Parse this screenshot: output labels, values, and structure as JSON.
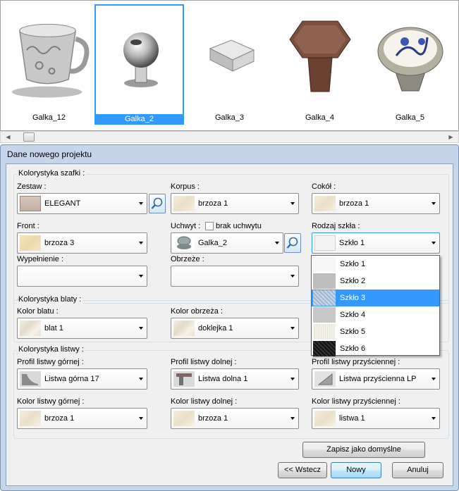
{
  "thumbnails": [
    {
      "name": "Galka_12",
      "selected": false
    },
    {
      "name": "Galka_2",
      "selected": true
    },
    {
      "name": "Galka_3",
      "selected": false
    },
    {
      "name": "Galka_4",
      "selected": false
    },
    {
      "name": "Galka_5",
      "selected": false
    }
  ],
  "dialog": {
    "title": "Dane nowego projektu",
    "cabinet_group": {
      "label": "Kolorystyka szafki :",
      "zestaw_label": "Zestaw :",
      "zestaw_value": "ELEGANT",
      "korpus_label": "Korpus :",
      "korpus_value": "brzoza 1",
      "cokol_label": "Cokół :",
      "cokol_value": "brzoza 1",
      "front_label": "Front :",
      "front_value": "brzoza 3",
      "uchwyt_label": "Uchwyt :",
      "brak_uchwytu_label": "brak uchwytu",
      "brak_uchwytu_checked": false,
      "uchwyt_value": "Galka_2",
      "rodzaj_szkla_label": "Rodzaj szkła :",
      "rodzaj_szkla_value": "Szkło 1",
      "wypelnienie_label": "Wypełnienie :",
      "wypelnienie_value": "",
      "obrzeze_label": "Obrzeże :",
      "obrzeze_value": ""
    },
    "glass_options": [
      {
        "label": "Szkło 1",
        "highlighted": false
      },
      {
        "label": "Szkło 2",
        "highlighted": false
      },
      {
        "label": "Szkło 3",
        "highlighted": true
      },
      {
        "label": "Szkło 4",
        "highlighted": false
      },
      {
        "label": "Szkło 5",
        "highlighted": false
      },
      {
        "label": "Szkło 6",
        "highlighted": false
      }
    ],
    "top_group": {
      "label": "Kolorystyka blaty :",
      "kolor_blatu_label": "Kolor blatu :",
      "kolor_blatu_value": "blat 1",
      "kolor_obrzeza_label": "Kolor obrzeża :",
      "kolor_obrzeza_value": "doklejka 1"
    },
    "strip_group": {
      "label": "Kolorystyka listwy :",
      "profil_gornej_label": "Profil listwy górnej :",
      "profil_gornej_value": "Listwa górna 17",
      "profil_dolnej_label": "Profil listwy dolnej :",
      "profil_dolnej_value": "Listwa dolna 1",
      "profil_przysciennej_label": "Profil listwy przyściennej :",
      "profil_przysciennej_value": "Listwa przyścienna LP",
      "kolor_gornej_label": "Kolor listwy górnej :",
      "kolor_gornej_value": "brzoza 1",
      "kolor_dolnej_label": "Kolor listwy dolnej :",
      "kolor_dolnej_value": "brzoza 1",
      "kolor_przysciennej_label": "Kolor listwy przyściennej :",
      "kolor_przysciennej_value": "listwa 1"
    },
    "buttons": {
      "save_default": "Zapisz jako domyślne",
      "back": "<< Wstecz",
      "new": "Nowy",
      "cancel": "Anuluj"
    }
  },
  "colors": {
    "selection": "#3399ff",
    "dialog_frame": "#c6d6ea"
  }
}
